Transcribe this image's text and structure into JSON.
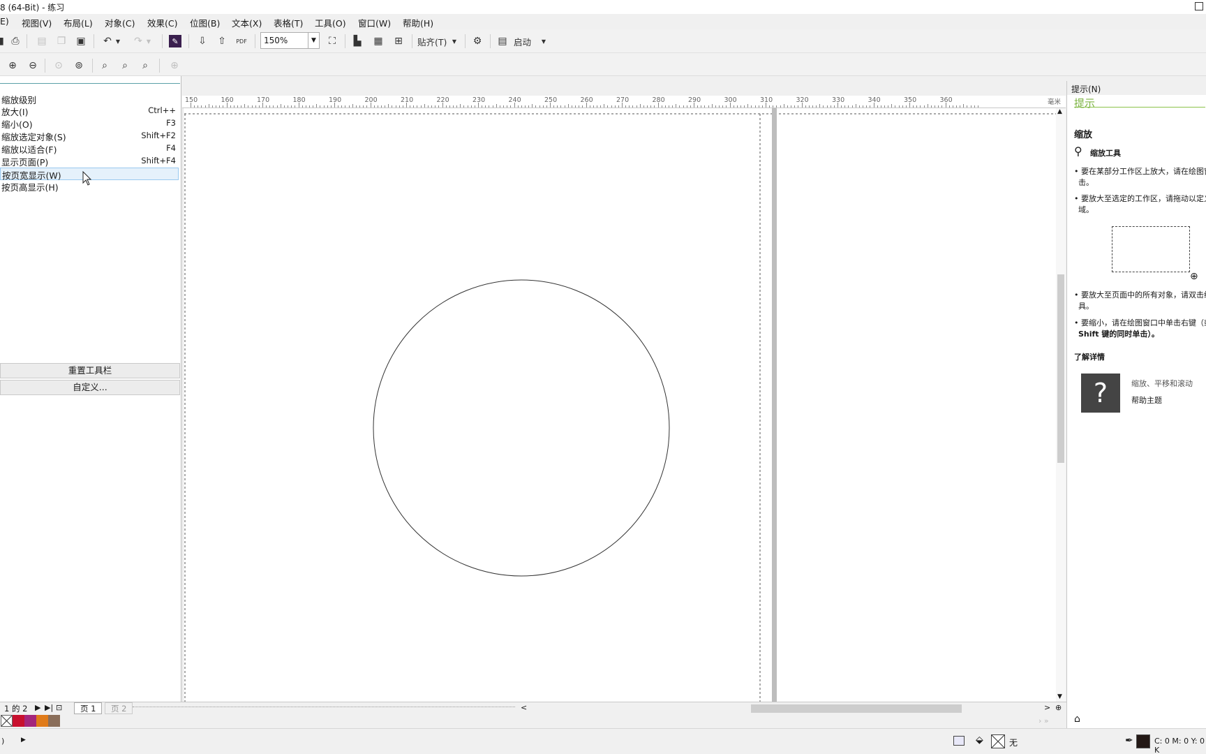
{
  "window": {
    "title": "8 (64-Bit) - 练习"
  },
  "menubar": {
    "items": [
      "E)",
      "视图(V)",
      "布局(L)",
      "对象(C)",
      "效果(C)",
      "位图(B)",
      "文本(X)",
      "表格(T)",
      "工具(O)",
      "窗口(W)",
      "帮助(H)"
    ]
  },
  "toolbar": {
    "zoom_value": "150%",
    "snap_label": "贴齐(T)",
    "launch_label": "启动",
    "pdf_label": "PDF"
  },
  "flyout": {
    "header": "缩放级别",
    "items": [
      {
        "label": "放大(I)",
        "shortcut": "Ctrl++"
      },
      {
        "label": "缩小(O)",
        "shortcut": "F3"
      },
      {
        "label": "缩放选定对象(S)",
        "shortcut": "Shift+F2"
      },
      {
        "label": "缩放以适合(F)",
        "shortcut": "F4"
      },
      {
        "label": "显示页面(P)",
        "shortcut": "Shift+F4"
      },
      {
        "label": "按页宽显示(W)",
        "shortcut": ""
      },
      {
        "label": "按页高显示(H)",
        "shortcut": ""
      }
    ],
    "selected_index": 5,
    "reset_button": "重置工具栏",
    "customize_button": "自定义..."
  },
  "ruler": {
    "labels": [
      "150",
      "160",
      "170",
      "180",
      "190",
      "200",
      "210",
      "220",
      "230",
      "240",
      "250",
      "260",
      "270",
      "280",
      "290",
      "300",
      "310",
      "320",
      "330",
      "340",
      "350",
      "360"
    ],
    "unit": "毫米"
  },
  "pages": {
    "counter": "1 的 2",
    "tabs": [
      "页 1",
      "页 2"
    ],
    "active": 0
  },
  "palette": {
    "colors": [
      "#c8102e",
      "#a4267c",
      "#e07b1a",
      "#8a6e5a"
    ]
  },
  "hints": {
    "panel_title": "提示(N)",
    "heading": "提示",
    "section": "缩放",
    "tool_name": "缩放工具",
    "p1_line1": "• 要在某部分工作区上放大，请在绘图窗",
    "p1_line2": "击。",
    "p2_line1": "• 要放大至选定的工作区，请拖动以定义",
    "p2_line2": "域。",
    "p3_line1": "• 要放大至页面中的所有对象，请双击缩",
    "p3_line2": "具。",
    "p4_line1": "• 要缩小，请在绘图窗口中单击右键（或",
    "p4_line2": "Shift 键的同时单击）。",
    "learn_more": "了解详情",
    "link1": "缩放、平移和滚动",
    "link2": "帮助主题",
    "help_glyph": "?"
  },
  "status": {
    "left_text": ")",
    "fill_none": "无",
    "color_readout": "C: 0 M: 0 Y: 0 K"
  }
}
